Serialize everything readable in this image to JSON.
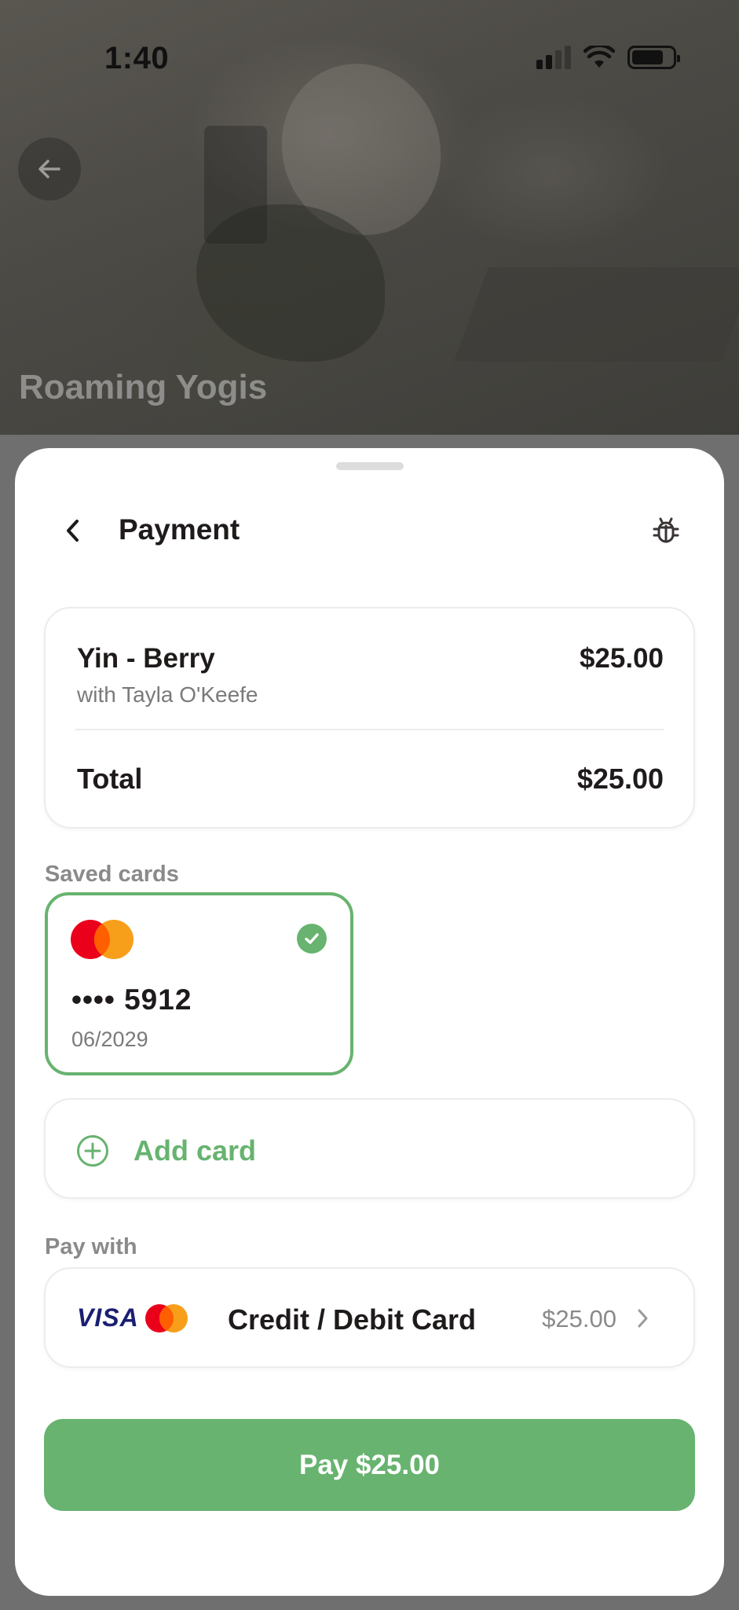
{
  "status_bar": {
    "time": "1:40"
  },
  "hero": {
    "title": "Roaming Yogis"
  },
  "header": {
    "title": "Payment"
  },
  "order": {
    "item_name": "Yin - Berry",
    "item_subtitle": "with Tayla O'Keefe",
    "item_price": "$25.00",
    "total_label": "Total",
    "total_value": "$25.00"
  },
  "saved_cards": {
    "label": "Saved cards",
    "cards": [
      {
        "brand": "mastercard",
        "number": "•••• 5912",
        "expiry": "06/2029",
        "selected": true
      }
    ]
  },
  "add_card": {
    "label": "Add card"
  },
  "pay_with": {
    "label": "Pay with",
    "method": {
      "visa_text": "VISA",
      "label": "Credit / Debit Card",
      "amount": "$25.00"
    }
  },
  "pay_button": {
    "label": "Pay $25.00"
  },
  "colors": {
    "accent": "#67b36f",
    "mastercard_red": "#eb001b",
    "mastercard_orange": "#f79e1b",
    "visa_blue": "#1a1f71"
  },
  "icons": {
    "back": "arrow-left-icon",
    "header_back": "chevron-left-icon",
    "debug": "bug-icon",
    "selected": "check-circle-icon",
    "add": "plus-circle-icon",
    "chevron": "chevron-right-icon"
  }
}
